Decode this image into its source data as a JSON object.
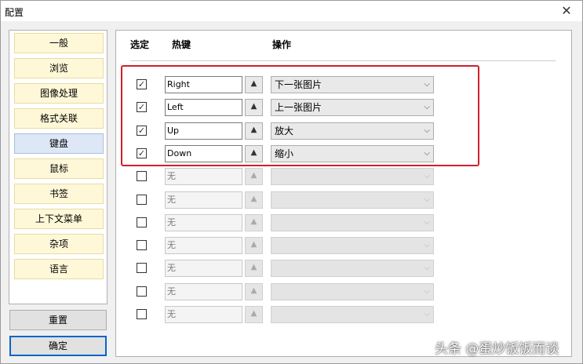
{
  "window": {
    "title": "配置"
  },
  "sidebar": {
    "items": [
      {
        "label": "一般",
        "active": false
      },
      {
        "label": "浏览",
        "active": false
      },
      {
        "label": "图像处理",
        "active": false
      },
      {
        "label": "格式关联",
        "active": false
      },
      {
        "label": "键盘",
        "active": true
      },
      {
        "label": "鼠标",
        "active": false
      },
      {
        "label": "书签",
        "active": false
      },
      {
        "label": "上下文菜单",
        "active": false
      },
      {
        "label": "杂项",
        "active": false
      },
      {
        "label": "语言",
        "active": false
      }
    ]
  },
  "buttons": {
    "reset": "重置",
    "ok": "确定"
  },
  "table": {
    "headers": {
      "select": "选定",
      "hotkey": "热键",
      "action": "操作"
    },
    "rows": [
      {
        "checked": true,
        "key": "Right",
        "action": "下一张图片",
        "enabled": true
      },
      {
        "checked": true,
        "key": "Left",
        "action": "上一张图片",
        "enabled": true
      },
      {
        "checked": true,
        "key": "Up",
        "action": "放大",
        "enabled": true
      },
      {
        "checked": true,
        "key": "Down",
        "action": "缩小",
        "enabled": true
      },
      {
        "checked": false,
        "key": "无",
        "action": "",
        "enabled": false
      },
      {
        "checked": false,
        "key": "无",
        "action": "",
        "enabled": false
      },
      {
        "checked": false,
        "key": "无",
        "action": "",
        "enabled": false
      },
      {
        "checked": false,
        "key": "无",
        "action": "",
        "enabled": false
      },
      {
        "checked": false,
        "key": "无",
        "action": "",
        "enabled": false
      },
      {
        "checked": false,
        "key": "无",
        "action": "",
        "enabled": false
      },
      {
        "checked": false,
        "key": "无",
        "action": "",
        "enabled": false
      }
    ]
  },
  "icons": {
    "close": "close-icon",
    "spin": "chevron-up-icon",
    "dropdown": "chevron-down-icon",
    "check": "checkmark-icon"
  },
  "colors": {
    "highlight": "#d0202a",
    "nav_bg": "#fff8d8",
    "nav_active_bg": "#dde7f5",
    "primary_border": "#0a64c8"
  },
  "watermark": "头条 @蛋炒饭饭而谈"
}
